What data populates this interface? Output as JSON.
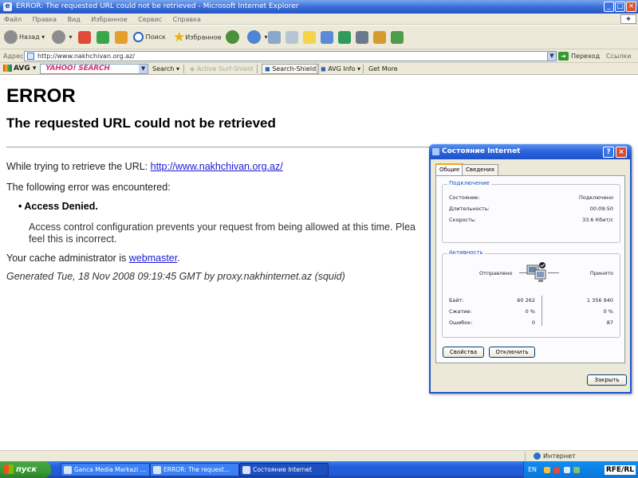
{
  "browser": {
    "title": "ERROR: The requested URL could not be retrieved - Microsoft Internet Explorer",
    "menu": [
      "Файл",
      "Правка",
      "Вид",
      "Избранное",
      "Сервис",
      "Справка"
    ],
    "toolbar": {
      "back": "Назад",
      "search": "Поиск",
      "favorites": "Избранное"
    },
    "address": {
      "label": "Адрес:",
      "url": "http://www.nakhchivan.org.az/",
      "go": "Переход",
      "links": "Ссылки"
    },
    "avg_bar": {
      "brand": "AVG",
      "search_box": "YAHOO! SEARCH",
      "search": "Search",
      "active_surf": "Active Surf-Shield",
      "search_shield": "Search-Shield",
      "avg_info": "AVG Info",
      "get_more": "Get More"
    },
    "status": {
      "zone": "Интернет"
    }
  },
  "page": {
    "h1": "ERROR",
    "h2": "The requested URL could not be retrieved",
    "line1_prefix": "While trying to retrieve the URL: ",
    "line1_link": "http://www.nakhchivan.org.az/",
    "line2": "The following error was encountered:",
    "bullet": "Access Denied.",
    "detail": "Access control configuration prevents your request from being allowed at this time. Plea",
    "detail2": "feel this is incorrect.",
    "cache_prefix": "Your cache administrator is ",
    "cache_link": "webmaster",
    "cache_suffix": ".",
    "generated": "Generated Tue, 18 Nov 2008 09:19:45 GMT by proxy.nakhinternet.az (squid)"
  },
  "dialog": {
    "title": "Состояние Internet",
    "tabs": [
      "Общие",
      "Сведения"
    ],
    "connection": {
      "label": "Подключение",
      "status_label": "Состояние:",
      "status_value": "Подключено",
      "duration_label": "Длительность:",
      "duration_value": "00:09:50",
      "speed_label": "Скорость:",
      "speed_value": "33.6 Кбит/с"
    },
    "activity": {
      "label": "Активность",
      "sent": "Отправлено",
      "received": "Принято",
      "bytes_label": "Байт:",
      "bytes_sent": "60 262",
      "bytes_received": "1 356 940",
      "compression_label": "Сжатие:",
      "compression_sent": "0 %",
      "compression_received": "0 %",
      "errors_label": "Ошибок:",
      "errors_sent": "0",
      "errors_received": "87"
    },
    "properties_button": "Свойства",
    "disconnect_button": "Отключить",
    "close_button": "Закрыть"
  },
  "taskbar": {
    "start": "пуск",
    "tasks": [
      "Ganca Media Markazi ...",
      "ERROR: The request...",
      "Состояние Internet"
    ],
    "lang": "EN",
    "watermark": "RFE/RL"
  }
}
